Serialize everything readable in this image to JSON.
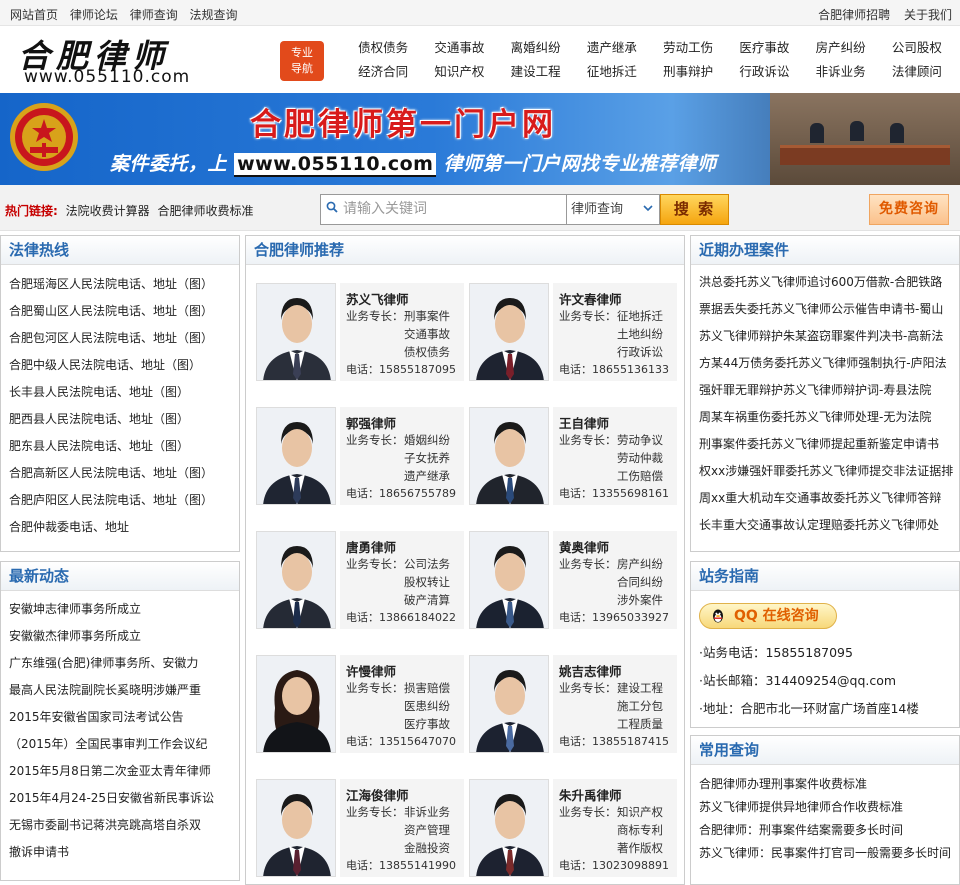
{
  "topbar": {
    "left_links": [
      "网站首页",
      "律师论坛",
      "律师查询",
      "法规查询"
    ],
    "right_links": [
      "合肥律师招聘",
      "关于我们"
    ]
  },
  "header": {
    "logo_text": "合肥律师",
    "logo_url": "www.055110.com",
    "nav_button": {
      "line1": "专业",
      "line2": "导航"
    },
    "nav_rows": [
      [
        "债权债务",
        "交通事故",
        "离婚纠纷",
        "遗产继承",
        "劳动工伤",
        "医疗事故",
        "房产纠纷",
        "公司股权"
      ],
      [
        "经济合同",
        "知识产权",
        "建设工程",
        "征地拆迁",
        "刑事辩护",
        "行政诉讼",
        "非诉业务",
        "法律顾问"
      ]
    ]
  },
  "banner": {
    "title": "合肥律师第一门户网",
    "slogan_pre": "案件委托，上 ",
    "slogan_url": "www.055110.com",
    "slogan_post": " 律师第一门户网找专业推荐律师"
  },
  "searchbar": {
    "hot_label": "热门链接:",
    "hot_links": [
      "法院收费计算器",
      "合肥律师收费标准"
    ],
    "placeholder": "请输入关键词",
    "select_value": "律师查询",
    "search_label": "搜 索",
    "consult_label": "免费咨询"
  },
  "hotline": {
    "title": "法律热线",
    "items": [
      "合肥瑶海区人民法院电话、地址（图）",
      "合肥蜀山区人民法院电话、地址（图）",
      "合肥包河区人民法院电话、地址（图）",
      "合肥中级人民法院电话、地址（图）",
      "长丰县人民法院电话、地址（图）",
      "肥西县人民法院电话、地址（图）",
      "肥东县人民法院电话、地址（图）",
      "合肥高新区人民法院电话、地址（图）",
      "合肥庐阳区人民法院电话、地址（图）",
      "合肥仲裁委电话、地址"
    ]
  },
  "news": {
    "title": "最新动态",
    "items": [
      "安徽坤志律师事务所成立",
      "安徽徽杰律师事务所成立",
      "广东维强(合肥)律师事务所、安徽力",
      "最高人民法院副院长奚晓明涉嫌严重",
      "2015年安徽省国家司法考试公告",
      "（2015年）全国民事审判工作会议纪",
      "2015年5月8日第二次金亚太青年律师",
      "2015年4月24-25日安徽省新民事诉讼",
      "无锡市委副书记蒋洪亮跳高塔自杀双",
      "撤诉申请书"
    ]
  },
  "recommend": {
    "title": "合肥律师推荐",
    "specialty_label": "业务专长：",
    "phone_label": "电话：",
    "lawyers": [
      {
        "name": "苏义飞律师",
        "specialties": [
          "刑事案件",
          "交通事故",
          "债权债务"
        ],
        "phone": "15855187095",
        "suit": "#2a2f3a",
        "tie": "#3a3f55"
      },
      {
        "name": "许文春律师",
        "specialties": [
          "征地拆迁",
          "土地纠纷",
          "行政诉讼"
        ],
        "phone": "18655136133",
        "suit": "#1e2330",
        "tie": "#7a1f2a"
      },
      {
        "name": "郭强律师",
        "specialties": [
          "婚姻纠纷",
          "子女抚养",
          "遗产继承"
        ],
        "phone": "18656755789",
        "suit": "#1f2532",
        "tie": "#2d3b5a"
      },
      {
        "name": "王自律师",
        "specialties": [
          "劳动争议",
          "劳动仲裁",
          "工伤赔偿"
        ],
        "phone": "13355698161",
        "suit": "#20242c",
        "tie": "#2a4a7a"
      },
      {
        "name": "唐勇律师",
        "specialties": [
          "公司法务",
          "股权转让",
          "破产清算"
        ],
        "phone": "13866184022",
        "suit": "#252a35",
        "tie": "#1c2c4a"
      },
      {
        "name": "黄奥律师",
        "specialties": [
          "房产纠纷",
          "合同纠纷",
          "涉外案件"
        ],
        "phone": "13965033927",
        "suit": "#1b2230",
        "tie": "#3a5a8a"
      },
      {
        "name": "许慢律师",
        "specialties": [
          "损害赔偿",
          "医患纠纷",
          "医疗事故"
        ],
        "phone": "13515647070",
        "suit": "#121418",
        "tie": "#121418"
      },
      {
        "name": "姚吉志律师",
        "specialties": [
          "建设工程",
          "施工分包",
          "工程质量"
        ],
        "phone": "13855187415",
        "suit": "#1c2230",
        "tie": "#4a6aa0"
      },
      {
        "name": "江海俊律师",
        "specialties": [
          "非诉业务",
          "资产管理",
          "金融投资"
        ],
        "phone": "13855141990",
        "suit": "#1f2430",
        "tie": "#5a2030"
      },
      {
        "name": "朱升禹律师",
        "specialties": [
          "知识产权",
          "商标专利",
          "著作版权"
        ],
        "phone": "13023098891",
        "suit": "#1d2230",
        "tie": "#7a2a2a"
      }
    ]
  },
  "cases": {
    "title": "近期办理案件",
    "items": [
      "洪总委托苏义飞律师追讨600万借款-合肥铁路",
      "票据丢失委托苏义飞律师公示催告申请书-蜀山",
      "苏义飞律师辩护朱某盗窃罪案件判决书-高新法",
      "方某44万债务委托苏义飞律师强制执行-庐阳法",
      "强奸罪无罪辩护苏义飞律师辩护词-寿县法院",
      "周某车祸重伤委托苏义飞律师处理-无为法院",
      "刑事案件委托苏义飞律师提起重新鉴定申请书",
      "权xx涉嫌强奸罪委托苏义飞律师提交非法证据排",
      "周xx重大机动车交通事故委托苏义飞律师答辩",
      "长丰重大交通事故认定理赔委托苏义飞律师处"
    ]
  },
  "guide": {
    "title": "站务指南",
    "qq_label": "QQ 在线咨询",
    "phone": "·站务电话：15855187095",
    "email": "·站长邮箱：314409254@qq.com",
    "address": "·地址：合肥市北一环财富广场首座14楼"
  },
  "query": {
    "title": "常用查询",
    "items": [
      "合肥律师办理刑事案件收费标准",
      "苏义飞律师提供异地律师合作收费标准",
      "合肥律师：刑事案件结案需要多长时间",
      "苏义飞律师：民事案件打官司一般需要多长时间"
    ]
  },
  "colors": {
    "accent_blue": "#2a6ab0",
    "search_orange": "#f5a50f",
    "hot_red": "#c60000",
    "banner_red": "#d81b1b",
    "nav_btn": "#e24a1b"
  }
}
